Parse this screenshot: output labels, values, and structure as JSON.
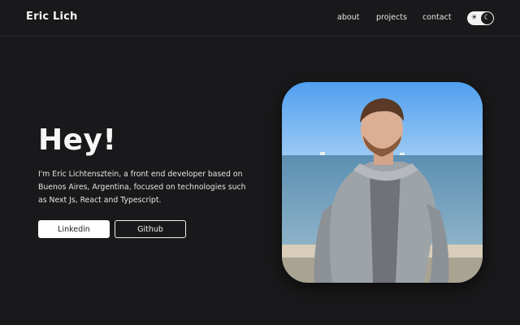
{
  "navbar": {
    "brand": "Eric Lich",
    "links": [
      {
        "label": "about"
      },
      {
        "label": "projects"
      },
      {
        "label": "contact"
      }
    ],
    "theme_toggle": {
      "left_icon": "sun-icon",
      "right_icon": "moon-icon",
      "left_glyph": "☀",
      "right_glyph": "☾"
    }
  },
  "hero": {
    "title": "Hey!",
    "description": "I'm Eric Lichtensztein, a front end developer based on Buenos Aires, Argentina, focused on technologies such as Next Js, React and Typescript.",
    "buttons": [
      {
        "label": "Linkedin"
      },
      {
        "label": "Github"
      }
    ],
    "photo_icon": "profile-photo"
  },
  "colors": {
    "background": "#19191b",
    "text": "#f4f4f4",
    "button_fill": "#ffffff"
  }
}
